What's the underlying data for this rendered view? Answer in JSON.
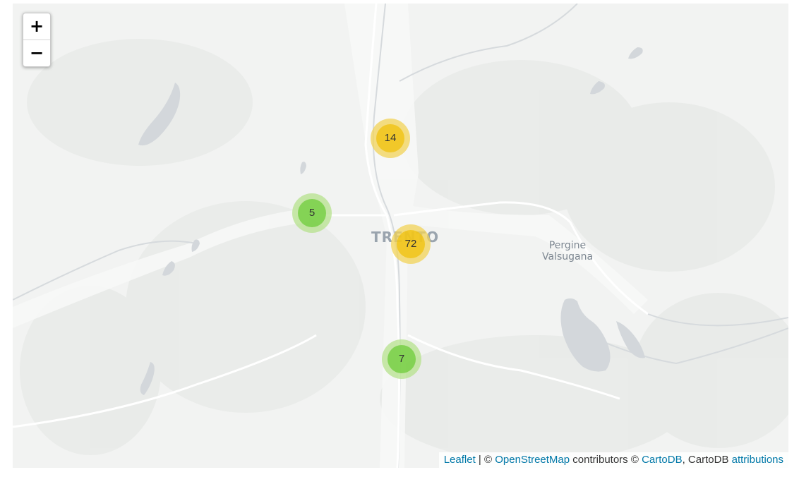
{
  "map": {
    "place_labels": {
      "city": "TRENTO",
      "town_line1": "Pergine",
      "town_line2": "Valsugana"
    },
    "zoom_control": {
      "zoom_in_label": "+",
      "zoom_out_label": "−"
    },
    "clusters": [
      {
        "count": "14",
        "size": "medium"
      },
      {
        "count": "5",
        "size": "small"
      },
      {
        "count": "72",
        "size": "medium"
      },
      {
        "count": "7",
        "size": "small"
      }
    ],
    "attribution": {
      "leaflet": "Leaflet",
      "sep1": " | © ",
      "osm": "OpenStreetMap",
      "contributors": " contributors © ",
      "cartodb": "CartoDB",
      "sep2": ", CartoDB ",
      "attributions": "attributions"
    },
    "colors": {
      "cluster_small_outer": "#b5e28c",
      "cluster_small_inner": "#6ecc39",
      "cluster_medium_outer": "#f1d357",
      "cluster_medium_inner": "#f0c20c",
      "water": "#d3d7db",
      "land": "#f2f3f2",
      "link": "#0078a8"
    }
  }
}
